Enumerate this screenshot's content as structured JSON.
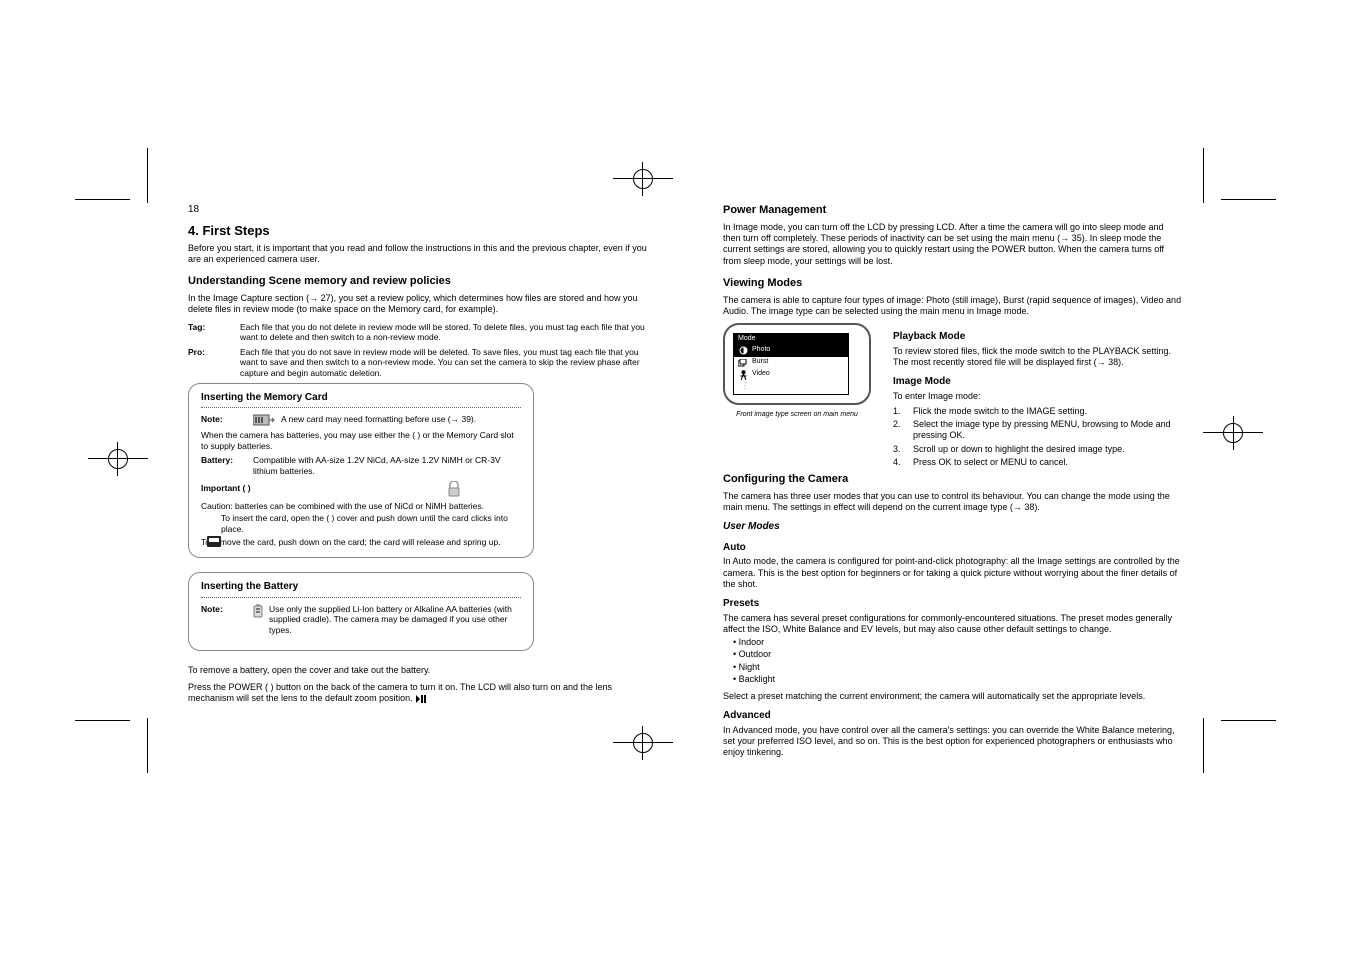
{
  "pageNumberLeft": "18",
  "chapter": "4. First Steps",
  "intro": "Before you start, it is important that you read and follow the instructions in this and the previous chapter, even if you are an experienced camera user.",
  "secPolicies": "Understanding Scene memory and review policies",
  "polIntro": "In the Image Capture section (→ 27), you set a review policy, which determines how files are stored and how you delete files in review mode (to make space on the Memory card, for example).",
  "polTag": "Tag:",
  "polPro": "Pro:",
  "polTagText": "Each file that you do not delete in review mode will be stored. To delete files, you must tag each file that you want to delete and then switch to a non-review mode.",
  "polBattery": "When the camera has batteries, you may use either the (    ) or the Memory Card slot to supply batteries.",
  "polBatteryBox": "Battery:",
  "polBatteryDesc": "Compatible with AA-size 1.2V NiCd, AA-size 1.2V NiMH or CR-3V lithium batteries.",
  "polNoteTitle": "Important   (   )",
  "polNote": "Caution: batteries can be combined with the use of NiCd or NiMH batteries.",
  "polProText": "Each file that you do not save in review mode will be deleted. To save files, you must tag each file that you want to save and then switch to a non-review mode. You can set the camera to skip the review phase after capture and begin automatic deletion.",
  "panel1": {
    "title": "Inserting the Memory Card",
    "note": "Note",
    "noteLabel": "Note:",
    "noteText": "A new card may need formatting before use (→ 39).",
    "insert": "To insert the card, open the (    ) cover and push down until the card clicks into place.",
    "remove": "To remove the card, push down on the card; the card will release and spring up."
  },
  "panel2": {
    "title": "Inserting the Battery",
    "note": "Note",
    "noteLabel": "Note:",
    "noteText": "Use only the supplied Li-Ion battery or Alkaline AA batteries (with supplied cradle). The camera may be damaged if you use other types."
  },
  "belowPanels1": "To remove a battery, open the cover and take out the battery.",
  "belowPanels2": "Press the POWER (    ) button on the back of the camera to turn it on. The LCD will also turn on and the lens mechanism will set the lens to the default zoom position.",
  "right": {
    "secTitle": "Power Management",
    "intro": "In Image mode, you can turn off the LCD by pressing LCD. After a time the camera will go into sleep mode and then turn off completely. These periods of inactivity can be set using the main menu (→ 35). In sleep mode the current settings are stored, allowing you to quickly restart using the POWER button. When the camera turns off from sleep mode, your settings will be lost.",
    "modesTitle": "Viewing Modes",
    "modesBody": "The camera is able to capture four types of image: Photo (still image), Burst (rapid sequence of images), Video and Audio. The image type can be selected using the main menu in Image mode.",
    "lcdHeader": "Mode",
    "lcdItems": [
      "Photo",
      "Burst",
      "Video"
    ],
    "lcdCaption": "Front image type screen on main menu",
    "playbackTitle": "Playback Mode",
    "playbackBody": "To review stored files, flick the mode switch to the PLAYBACK setting. The most recently stored file will be displayed first (→ 38).",
    "imageTitle": "Image Mode",
    "imageIntro": "To enter Image mode:",
    "imageSteps": [
      "Flick the mode switch to the IMAGE setting.",
      "Select the image type by pressing MENU, browsing to Mode and pressing OK.",
      "Scroll up or down to highlight the desired image type.",
      "Press OK to select or MENU to cancel."
    ],
    "confTitle": "Configuring the Camera",
    "confBody": "The camera has three user modes that you can use to control its behaviour. You can change the mode using the main menu. The settings in effect will depend on the current image type (→ 38).",
    "userModesTitle": "User Modes",
    "autoTitle": "Auto",
    "autoBody": "In Auto mode, the camera is configured for point-and-click photography: all the Image settings are controlled by the camera. This is the best option for beginners or for taking a quick picture without worrying about the finer details of the shot.",
    "presetsTitle": "Presets",
    "presetsBody": "The camera has several preset configurations for commonly-encountered situations. The preset modes generally affect the ISO, White Balance and EV levels, but may also cause other default settings to change.",
    "bullets": [
      "Indoor",
      "Outdoor",
      "Night",
      "Backlight"
    ],
    "presetsTail": "Select a preset matching the current environment; the camera will automatically set the appropriate levels.",
    "advTitle": "Advanced",
    "advBody": "In Advanced mode, you have control over all the camera's settings: you can override the White Balance metering, set your preferred ISO level, and so on. This is the best option for experienced photographers or enthusiasts who enjoy tinkering."
  }
}
